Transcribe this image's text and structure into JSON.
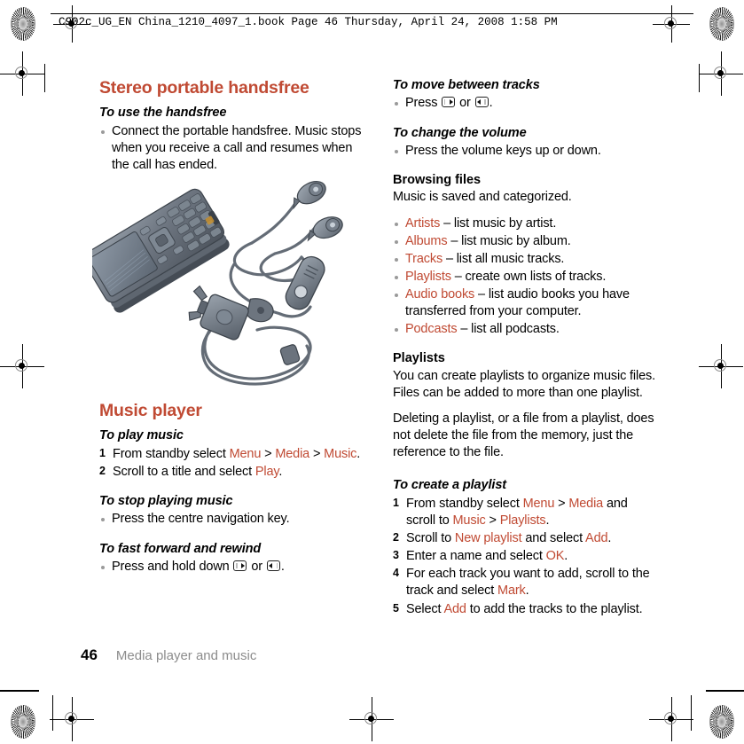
{
  "print_header": {
    "text": "C902c_UG_EN China_1210_4097_1.book  Page 46  Thursday, April 24, 2008  1:58 PM"
  },
  "colors": {
    "accent": "#c04a33",
    "body_text": "#000000",
    "footer_title": "#8c8c8c",
    "bullet": "#9a9a9a"
  },
  "left_column": {
    "section_title": "Stereo portable handsfree",
    "handsfree_task": {
      "heading": "To use the handsfree",
      "bullets": [
        "Connect the portable handsfree. Music stops when you receive a call and resumes when the call has ended."
      ]
    },
    "illustration": {
      "caption": "phone-with-stereo-portable-handsfree-illustration"
    },
    "music_player_title": "Music player",
    "play_music": {
      "heading": "To play music",
      "steps": [
        {
          "prefix": "From standby select ",
          "term1": "Menu",
          "sep1": " > ",
          "term2": "Media",
          "sep2": " > ",
          "term3": "Music",
          "suffix": "."
        },
        {
          "prefix": "Scroll to a title and select ",
          "term1": "Play",
          "suffix": "."
        }
      ]
    },
    "stop_music": {
      "heading": "To stop playing music",
      "bullets": [
        "Press the centre navigation key."
      ]
    },
    "fast_forward": {
      "heading": "To fast forward and rewind",
      "bullet_prefix": "Press and hold down ",
      "bullet_mid": " or ",
      "bullet_suffix": ".",
      "icon_right": "nav-key-right-icon",
      "icon_left": "nav-key-left-icon"
    }
  },
  "right_column": {
    "move_tracks": {
      "heading": "To move between tracks",
      "bullet_prefix": "Press ",
      "bullet_mid": " or ",
      "bullet_suffix": ".",
      "icon_right": "nav-key-right-icon",
      "icon_left": "nav-key-left-icon"
    },
    "change_volume": {
      "heading": "To change the volume",
      "bullets": [
        "Press the volume keys up or down."
      ]
    },
    "browsing_files": {
      "heading": "Browsing files",
      "intro": "Music is saved and categorized.",
      "items": [
        {
          "term": "Artists",
          "desc": " – list music by artist."
        },
        {
          "term": "Albums",
          "desc": " – list music by album."
        },
        {
          "term": "Tracks",
          "desc": " – list all music tracks."
        },
        {
          "term": "Playlists",
          "desc": " – create own lists of tracks."
        },
        {
          "term": "Audio books",
          "desc": " – list audio books you have transferred from your computer."
        },
        {
          "term": "Podcasts",
          "desc": " – list all podcasts."
        }
      ]
    },
    "playlists": {
      "heading": "Playlists",
      "paragraph1": "You can create playlists to organize music files. Files can be added to more than one playlist.",
      "paragraph2": "Deleting a playlist, or a file from a playlist, does not delete the file from the memory, just the reference to the file."
    },
    "create_playlist": {
      "heading": "To create a playlist",
      "steps": [
        {
          "prefix": "From standby select ",
          "term1": "Menu",
          "sep1": " > ",
          "term2": "Media",
          "mid": " and scroll to ",
          "term3": "Music",
          "sep2": " > ",
          "term4": "Playlists",
          "suffix": "."
        },
        {
          "prefix": "Scroll to ",
          "term1": "New playlist",
          "mid": " and select ",
          "term2": "Add",
          "suffix": "."
        },
        {
          "prefix": "Enter a name and select ",
          "term1": "OK",
          "suffix": "."
        },
        {
          "prefix": "For each track you want to add, scroll to the track and select ",
          "term1": "Mark",
          "suffix": "."
        },
        {
          "prefix": "Select ",
          "term1": "Add",
          "mid": " to add the tracks to the playlist.",
          "suffix": ""
        }
      ]
    }
  },
  "footer": {
    "page_number": "46",
    "chapter_title": "Media player and music"
  }
}
